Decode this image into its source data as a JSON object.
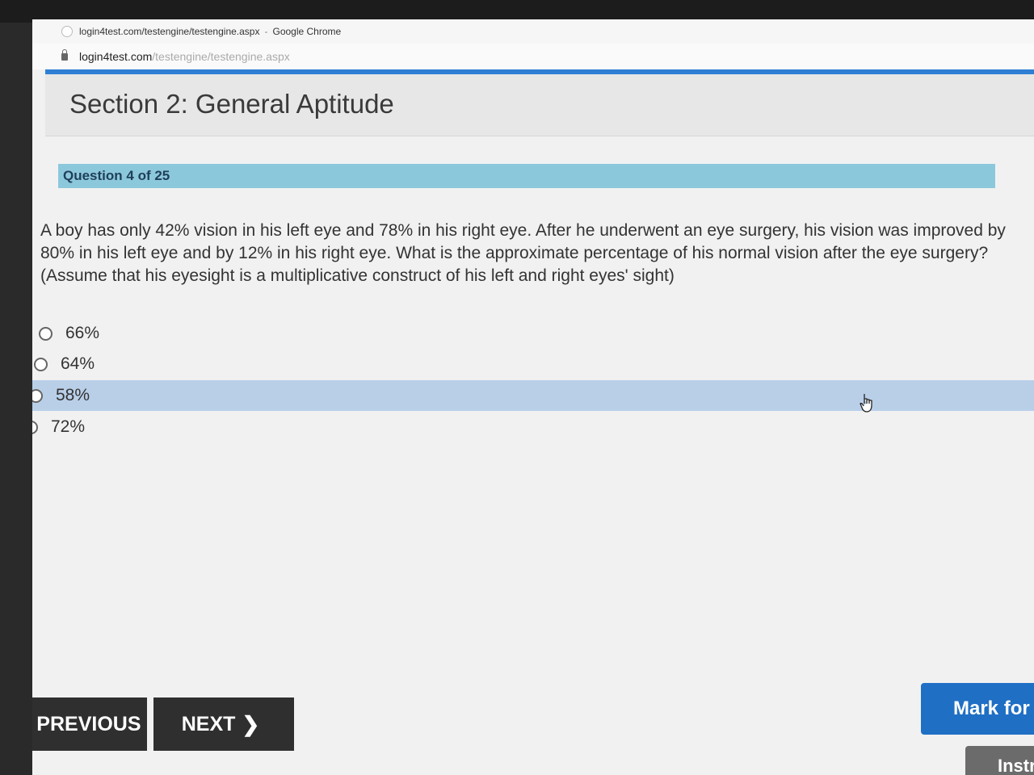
{
  "window": {
    "title": "login4test.com/testengine/testengine.aspx",
    "app": "Google Chrome"
  },
  "address": {
    "domain": "login4test.com",
    "path": "/testengine/testengine.aspx"
  },
  "header": {
    "section_title": "Section 2: General Aptitude"
  },
  "question": {
    "counter": "Question 4 of 25",
    "text": "A boy has only 42% vision in his left eye and 78% in his right eye. After he underwent an eye surgery, his vision was improved by 80% in his left eye and by 12% in his right eye. What is the approximate percentage of his normal vision after the eye surgery? (Assume that his eyesight is a multiplicative construct of his left and right eyes' sight)",
    "options": [
      {
        "label": "66%"
      },
      {
        "label": "64%"
      },
      {
        "label": "58%"
      },
      {
        "label": "72%"
      }
    ]
  },
  "nav": {
    "previous_label": "PREVIOUS",
    "next_label": "NEXT",
    "mark_label": "Mark for R",
    "instructions_label": "Instr"
  },
  "colors": {
    "accent_blue": "#2f7fd4",
    "question_bar": "#8cc8dc",
    "selected_row": "#b9cfe8",
    "nav_button": "#2f2f2f",
    "mark_button": "#1f6fc4"
  }
}
